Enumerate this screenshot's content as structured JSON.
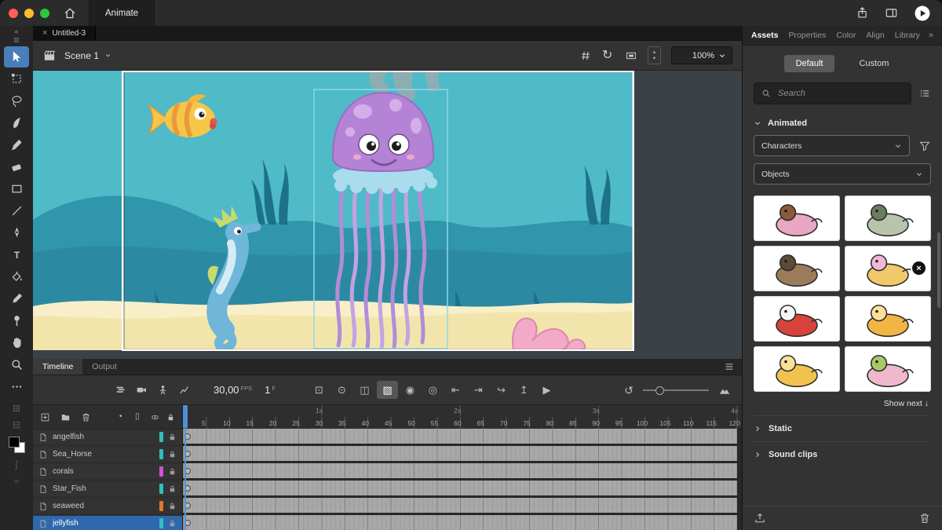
{
  "window": {
    "app_tab": "Animate",
    "doc_tab": "Untitled-3",
    "icons": [
      {
        "name": "share-icon",
        "icon": "share"
      },
      {
        "name": "workspace-icon",
        "icon": "workspace"
      },
      {
        "name": "quick-publish-icon",
        "icon": "playcircle"
      }
    ]
  },
  "scene_bar": {
    "scene_label": "Scene 1",
    "zoom_value": "100%",
    "icons": [
      {
        "name": "snap-grid-icon",
        "icon": "grid"
      },
      {
        "name": "rotation-icon",
        "glyph": "↻"
      },
      {
        "name": "clip-bounds-icon",
        "icon": "bounds"
      }
    ]
  },
  "tools": [
    {
      "name": "selection-tool",
      "icon": "cursor",
      "active": true
    },
    {
      "name": "free-transform-tool",
      "icon": "transform"
    },
    {
      "name": "lasso-tool",
      "icon": "lasso"
    },
    {
      "name": "fluid-brush-tool",
      "icon": "fluidbrush"
    },
    {
      "name": "classic-brush-tool",
      "icon": "brush"
    },
    {
      "name": "eraser-tool",
      "icon": "eraser"
    },
    {
      "name": "rectangle-tool",
      "icon": "rect"
    },
    {
      "name": "line-tool",
      "icon": "line"
    },
    {
      "name": "pen-tool",
      "icon": "pen"
    },
    {
      "name": "text-tool",
      "icon": "text"
    },
    {
      "name": "paint-bucket-tool",
      "icon": "bucket"
    },
    {
      "name": "eyedropper-tool",
      "icon": "dropper"
    },
    {
      "name": "asset-warp-tool",
      "icon": "pin"
    },
    {
      "name": "hand-tool",
      "icon": "hand"
    },
    {
      "name": "zoom-tool",
      "icon": "zoom"
    },
    {
      "name": "edit-toolbar-button",
      "icon": "dots"
    }
  ],
  "rail_extras": [
    {
      "name": "onion-marker-icon",
      "glyph": "⊞"
    },
    {
      "name": "frame-picker-icon",
      "glyph": "⊟"
    },
    {
      "name": "color-swatch",
      "glyph": ""
    },
    {
      "name": "curve-easing-icon",
      "glyph": "∫"
    },
    {
      "name": "wave-icon",
      "glyph": "≈"
    }
  ],
  "timeline": {
    "tabs": [
      {
        "label": "Timeline",
        "active": true
      },
      {
        "label": "Output",
        "active": false
      }
    ],
    "fps": "30,00",
    "fps_unit": "FPS",
    "current_frame": "1",
    "frame_unit": "F",
    "toolbar": {
      "left_buttons": [
        {
          "name": "layer-view-button",
          "icon": "layers"
        },
        {
          "name": "add-camera-button",
          "icon": "camera"
        },
        {
          "name": "layer-parenting-button",
          "icon": "rig"
        },
        {
          "name": "graph-editor-button",
          "icon": "graph"
        }
      ],
      "center_buttons": [
        {
          "name": "center-frame-button",
          "glyph": "⊡"
        },
        {
          "name": "loop-range-button",
          "glyph": "⊙"
        },
        {
          "name": "split-view-button",
          "glyph": "◫"
        },
        {
          "name": "edit-multiple-frames-button",
          "glyph": "▨",
          "active": true
        },
        {
          "name": "onion-skin-button",
          "glyph": "◉"
        },
        {
          "name": "onion-skin-outline-button",
          "glyph": "◎"
        },
        {
          "name": "prev-keyframe-button",
          "glyph": "⇤"
        },
        {
          "name": "next-keyframe-button",
          "glyph": "⇥"
        },
        {
          "name": "step-forward-button",
          "glyph": "↪"
        },
        {
          "name": "export-frame-button",
          "glyph": "↥"
        },
        {
          "name": "play-button",
          "glyph": "▶"
        }
      ],
      "loop_glyph": "↺"
    },
    "layer_header": {
      "left": [
        {
          "name": "new-layer-button",
          "icon": "plussq"
        },
        {
          "name": "new-folder-button",
          "icon": "folder"
        },
        {
          "name": "delete-layer-button",
          "icon": "trash"
        }
      ],
      "right": [
        {
          "name": "highlight-column-icon",
          "glyph": "•"
        },
        {
          "name": "camera-column-icon",
          "glyph": "▯"
        },
        {
          "name": "visibility-column-icon",
          "icon": "eye"
        },
        {
          "name": "lock-column-icon",
          "icon": "lock"
        }
      ]
    },
    "layers": [
      {
        "name": "angelfish",
        "color": "#2fbdc5",
        "selected": false
      },
      {
        "name": "Sea_Horse",
        "color": "#2fbdc5",
        "selected": false
      },
      {
        "name": "corals",
        "color": "#cf53cf",
        "selected": false
      },
      {
        "name": "Star_Fish",
        "color": "#2fbdc5",
        "selected": false
      },
      {
        "name": "seaweed",
        "color": "#e0782f",
        "selected": false
      },
      {
        "name": "jellyfish",
        "color": "#2fbdc5",
        "selected": true
      }
    ],
    "ruler": {
      "frame_numbers": [
        5,
        10,
        15,
        20,
        25,
        30,
        35,
        40,
        45,
        50,
        55,
        60,
        65,
        70,
        75,
        80,
        85,
        90,
        95,
        100,
        105,
        110,
        115,
        120
      ],
      "second_marks": [
        {
          "label": "1s",
          "frame": 30
        },
        {
          "label": "2s",
          "frame": 60
        },
        {
          "label": "3s",
          "frame": 90
        },
        {
          "label": "4s",
          "frame": 120
        }
      ]
    }
  },
  "assets_panel": {
    "tabs": [
      {
        "label": "Assets",
        "active": true
      },
      {
        "label": "Properties",
        "active": false
      },
      {
        "label": "Color",
        "active": false
      },
      {
        "label": "Align",
        "active": false
      },
      {
        "label": "Library",
        "active": false
      }
    ],
    "view_tabs": [
      {
        "label": "Default",
        "active": true
      },
      {
        "label": "Custom",
        "active": false
      }
    ],
    "search_placeholder": "Search",
    "sections": [
      {
        "label": "Animated",
        "expanded": true
      },
      {
        "label": "Static",
        "expanded": false
      },
      {
        "label": "Sound clips",
        "expanded": false
      }
    ],
    "filters": [
      "Characters",
      "Objects"
    ],
    "assets": [
      {
        "name": "monkey-on-pig",
        "c1": "#e8a7c2",
        "c2": "#8a5a3a"
      },
      {
        "name": "zombie-boy",
        "c1": "#b9c4ad",
        "c2": "#6b7d5f"
      },
      {
        "name": "wolf",
        "c1": "#9c7b5c",
        "c2": "#5f4a38"
      },
      {
        "name": "snail",
        "c1": "#f0c96a",
        "c2": "#f2b8d8",
        "badge": "×"
      },
      {
        "name": "santa-claus",
        "c1": "#d8423c",
        "c2": "#f5f5f5"
      },
      {
        "name": "yellow-dog-running",
        "c1": "#f2b544",
        "c2": "#fbe09a"
      },
      {
        "name": "yellow-dog-sitting",
        "c1": "#f2c24e",
        "c2": "#fbe09a"
      },
      {
        "name": "pink-jellyfish",
        "c1": "#f0b8cc",
        "c2": "#a8c86a"
      }
    ],
    "show_next_label": "Show next ↓"
  },
  "stage": {
    "selected_object": "jellyfish",
    "characters": [
      "angelfish",
      "jellyfish",
      "sea-horse",
      "star-fish",
      "seaweed",
      "corals"
    ],
    "colors": {
      "water": "#4fbac8",
      "hills": "#2f96ab",
      "sand": "#f2e5ab",
      "selection_outline": "#8fd8e8",
      "accent_blue": "#4a7dbc",
      "playhead": "#4e90d6"
    }
  }
}
